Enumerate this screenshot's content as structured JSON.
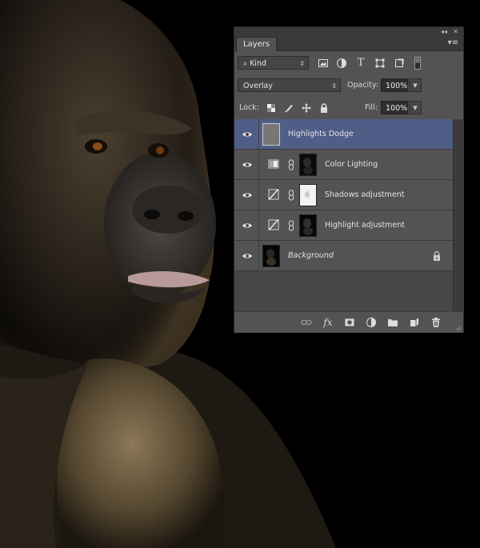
{
  "panel": {
    "tab_label": "Layers",
    "collapse_glyph": "◂◂",
    "close_glyph": "✕",
    "menu_glyph": "▾≡"
  },
  "filter": {
    "kind_label": "Kind",
    "icons": [
      "pixel-filter-icon",
      "adjustment-filter-icon",
      "type-filter-icon",
      "shape-filter-icon",
      "smart-object-filter-icon",
      "filter-toggle-icon"
    ]
  },
  "blend": {
    "mode": "Overlay",
    "opacity_label": "Opacity:",
    "opacity_value": "100%"
  },
  "lock": {
    "label": "Lock:",
    "icons": [
      "lock-transparent-icon",
      "lock-pixels-icon",
      "lock-position-icon",
      "lock-all-icon"
    ],
    "fill_label": "Fill:",
    "fill_value": "100%"
  },
  "layers": [
    {
      "name": "Highlights Dodge",
      "type": "pixel",
      "selected": true,
      "visible": true
    },
    {
      "name": "Color Lighting",
      "type": "gradient-map",
      "selected": false,
      "visible": true
    },
    {
      "name": "Shadows adjustment",
      "type": "curves",
      "selected": false,
      "visible": true
    },
    {
      "name": "Highlight adjustment",
      "type": "curves",
      "selected": false,
      "visible": true
    },
    {
      "name": "Background",
      "type": "background",
      "selected": false,
      "visible": true,
      "locked": true
    }
  ],
  "bottom_icons": [
    "link-layers-icon",
    "fx-icon",
    "add-mask-icon",
    "new-adjustment-icon",
    "new-group-icon",
    "new-layer-icon",
    "trash-icon"
  ],
  "bottom_fx_label": "fx"
}
